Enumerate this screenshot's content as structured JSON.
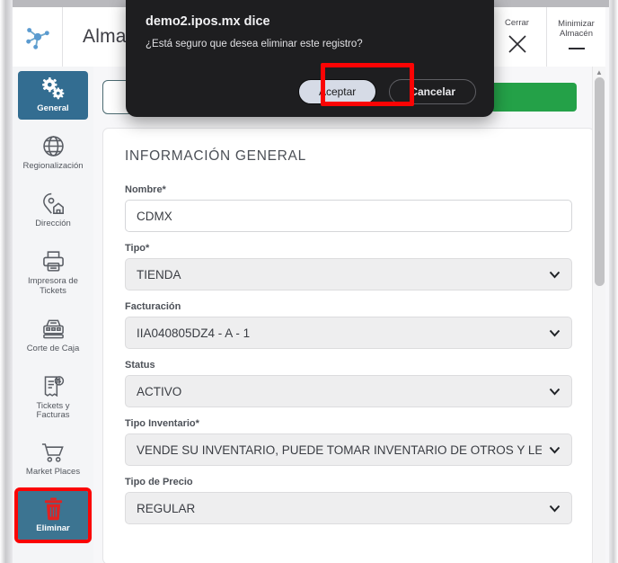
{
  "window": {
    "header": {
      "logo_icon": "network-nodes-icon",
      "title": "Almacén",
      "buttons": [
        {
          "label": "Cerrar",
          "icon": "close-x-icon"
        },
        {
          "label": "Minimizar Almacén",
          "icon": "minimize-dash-icon"
        }
      ]
    }
  },
  "sidebar": {
    "items": [
      {
        "label": "General",
        "icon": "gears-icon",
        "state": "active"
      },
      {
        "label": "Regionalización",
        "icon": "globe-icon",
        "state": "normal"
      },
      {
        "label": "Dirección",
        "icon": "map-pin-house-icon",
        "state": "normal"
      },
      {
        "label": "Impresora de Tickets",
        "icon": "printer-icon",
        "state": "normal"
      },
      {
        "label": "Corte de Caja",
        "icon": "cash-register-icon",
        "state": "normal"
      },
      {
        "label": "Tickets y Facturas",
        "icon": "invoice-dollar-icon",
        "state": "normal"
      },
      {
        "label": "Market Places",
        "icon": "shopping-cart-icon",
        "state": "normal"
      },
      {
        "label": "Eliminar",
        "icon": "trash-icon",
        "state": "danger-highlighted"
      }
    ]
  },
  "main": {
    "card_title": "INFORMACIÓN GENERAL",
    "fields": [
      {
        "label": "Nombre*",
        "value": "CDMX",
        "type": "text"
      },
      {
        "label": "Tipo*",
        "value": "TIENDA",
        "type": "select"
      },
      {
        "label": "Facturación",
        "value": "IIA040805DZ4 - A - 1",
        "type": "select"
      },
      {
        "label": "Status",
        "value": "ACTIVO",
        "type": "select"
      },
      {
        "label": "Tipo Inventario*",
        "value": "VENDE SU INVENTARIO, PUEDE TOMAR INVENTARIO DE OTROS Y LE PUE",
        "type": "select"
      },
      {
        "label": "Tipo de Precio",
        "value": "REGULAR",
        "type": "select"
      }
    ]
  },
  "dialog": {
    "title": "demo2.ipos.mx dice",
    "message": "¿Está seguro que desea eliminar este registro?",
    "accept_label": "Aceptar",
    "cancel_label": "Cancelar"
  },
  "colors": {
    "accent_blue": "#336d91",
    "danger_red": "#fb0404",
    "success_green": "#24a148",
    "dialog_bg": "#1e1e20"
  }
}
